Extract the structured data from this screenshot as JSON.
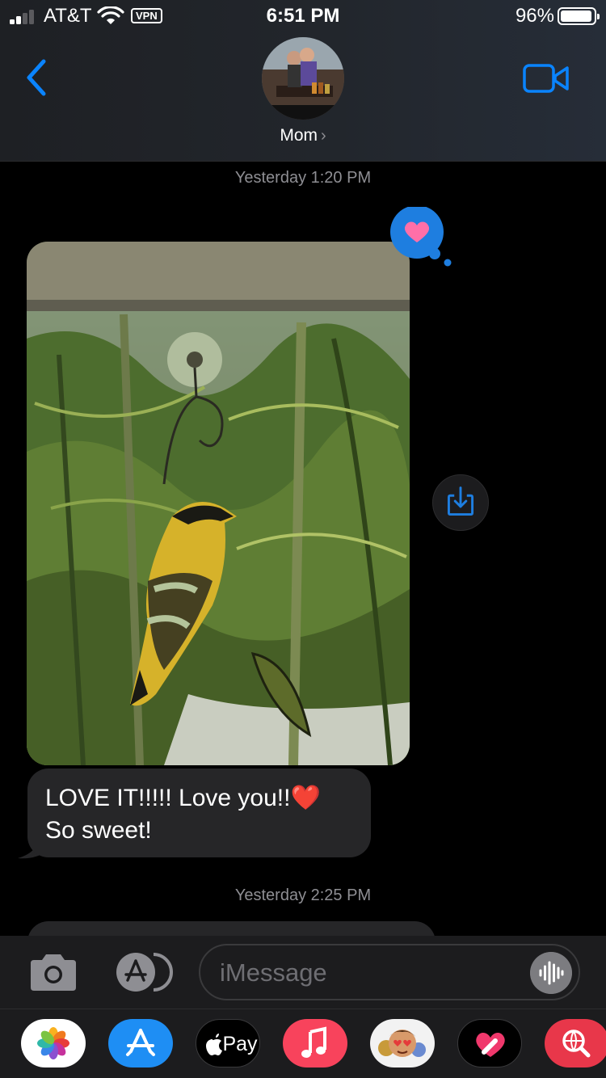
{
  "status_bar": {
    "carrier": "AT&T",
    "vpn": "VPN",
    "time": "6:51 PM",
    "battery_percent": "96%",
    "battery_level": 0.96,
    "signal_bars_filled": 2,
    "signal_bars_total": 4
  },
  "header": {
    "contact_name": "Mom",
    "chevron": "›",
    "back_icon": "chevron-left-icon",
    "video_icon": "video-camera-icon",
    "accent_color": "#0a84ff"
  },
  "conversation": {
    "timestamp_1": "Yesterday 1:20 PM",
    "photo_reaction": "heart",
    "incoming_message": "LOVE IT!!!!! Love you!!❤️\nSo sweet!",
    "timestamp_2": "Yesterday 2:25 PM"
  },
  "input_bar": {
    "placeholder": "iMessage"
  },
  "app_strip": {
    "apps": [
      "photos-icon",
      "app-store-icon",
      "apple-pay-icon",
      "music-icon",
      "memoji-icon",
      "digital-touch-icon",
      "web-search-icon"
    ],
    "apple_pay_label": "Pay"
  }
}
